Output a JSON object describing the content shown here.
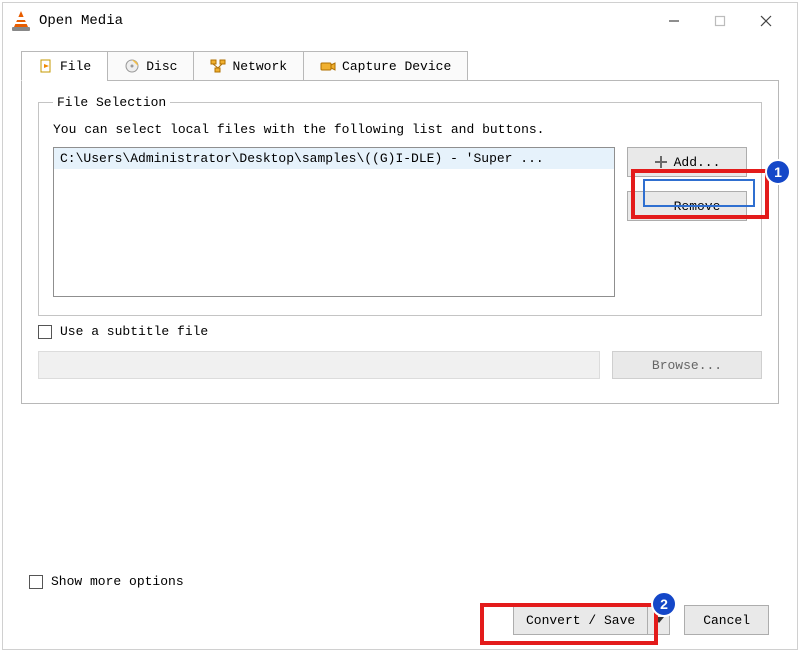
{
  "window": {
    "title": "Open Media"
  },
  "tabs": {
    "file": "File",
    "disc": "Disc",
    "network": "Network",
    "capture": "Capture Device"
  },
  "file_selection": {
    "legend": "File Selection",
    "hint": "You can select local files with the following list and buttons.",
    "items": [
      "C:\\Users\\Administrator\\Desktop\\samples\\((G)I-DLE) - 'Super ..."
    ],
    "add_label": "Add...",
    "remove_label": "Remove"
  },
  "subtitle": {
    "checkbox_label": "Use a subtitle file",
    "browse_label": "Browse..."
  },
  "options": {
    "show_more": "Show more options"
  },
  "buttons": {
    "convert_save": "Convert / Save",
    "cancel": "Cancel"
  },
  "callouts": {
    "c1": "1",
    "c2": "2"
  }
}
